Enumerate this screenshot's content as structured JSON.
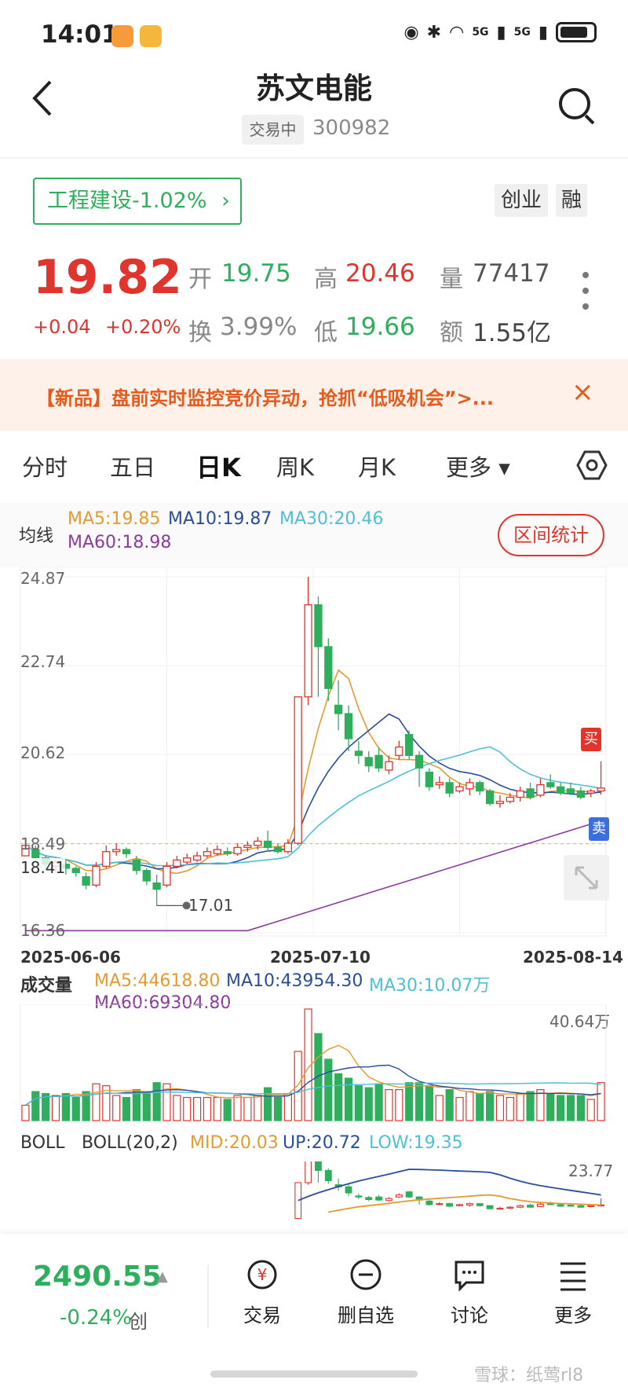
{
  "status_bar": {
    "time": "14:01",
    "network_1": "5G",
    "network_2": "5G",
    "colors": {
      "badge1": "#f59b3a",
      "badge2": "#f5b73a"
    }
  },
  "header": {
    "title": "苏文电能",
    "trading_status": "交易中",
    "code": "300982"
  },
  "sector": {
    "label": "工程建设-1.02%",
    "tags": [
      "创业",
      "融"
    ]
  },
  "quote": {
    "price": "19.82",
    "change": "+0.04",
    "change_pct": "+0.20%",
    "open_label": "开",
    "open": "19.75",
    "high_label": "高",
    "high": "20.46",
    "volume_label": "量",
    "volume": "77417",
    "turnover_label": "换",
    "turnover": "3.99%",
    "low_label": "低",
    "low": "19.66",
    "amount_label": "额",
    "amount": "1.55亿"
  },
  "promo": {
    "text": "【新品】盘前实时监控竞价异动，抢抓“低吸机会”>...",
    "close": "×"
  },
  "period_tabs": [
    "分时",
    "五日",
    "日K",
    "周K",
    "月K",
    "更多 ▾"
  ],
  "active_tab": "日K",
  "ma_legend": {
    "label": "均线",
    "ma5": "MA5:19.85",
    "ma10": "MA10:19.87",
    "ma30": "MA30:20.46",
    "ma60": "MA60:18.98",
    "range_button": "区间统计"
  },
  "colors": {
    "up": "#e0342c",
    "down": "#2fae5d",
    "ma5": "#e59a2f",
    "ma10": "#2a4d9b",
    "ma30": "#4fbfd6",
    "ma60": "#8a3b9c"
  },
  "chart_data": [
    {
      "type": "candlestick",
      "y_ticks": [
        "24.87",
        "22.74",
        "20.62",
        "18.49",
        "16.36"
      ],
      "ylim": [
        16.36,
        24.87
      ],
      "x_labels": [
        "2025-06-06",
        "2025-07-10",
        "2025-08-14"
      ],
      "annotations": {
        "current_line": "18.41",
        "low_marker": "17.01",
        "buy_mark": "买",
        "sell_mark": "卖"
      },
      "candles": [
        [
          18.2,
          18.45,
          18.0,
          17.95
        ],
        [
          18.35,
          18.15,
          18.45,
          18.05
        ],
        [
          18.15,
          18.0,
          18.2,
          17.85
        ],
        [
          17.95,
          18.05,
          18.1,
          17.8
        ],
        [
          18.0,
          17.9,
          18.1,
          17.75
        ],
        [
          17.9,
          17.8,
          17.95,
          17.7
        ],
        [
          17.7,
          17.5,
          17.8,
          17.4
        ],
        [
          17.5,
          17.95,
          18.05,
          17.45
        ],
        [
          17.95,
          18.3,
          18.45,
          17.9
        ],
        [
          18.3,
          18.35,
          18.5,
          18.2
        ],
        [
          18.35,
          18.25,
          18.4,
          18.15
        ],
        [
          18.1,
          17.85,
          18.2,
          17.75
        ],
        [
          17.85,
          17.6,
          17.9,
          17.5
        ],
        [
          17.55,
          17.4,
          17.75,
          17.01
        ],
        [
          17.5,
          17.95,
          18.05,
          17.45
        ],
        [
          17.95,
          18.1,
          18.2,
          17.9
        ],
        [
          18.05,
          18.15,
          18.25,
          18.0
        ],
        [
          18.1,
          18.2,
          18.3,
          18.05
        ],
        [
          18.2,
          18.3,
          18.4,
          18.15
        ],
        [
          18.25,
          18.35,
          18.45,
          18.2
        ],
        [
          18.3,
          18.25,
          18.4,
          18.2
        ],
        [
          18.25,
          18.4,
          18.5,
          18.2
        ],
        [
          18.4,
          18.45,
          18.55,
          18.3
        ],
        [
          18.45,
          18.55,
          18.65,
          18.35
        ],
        [
          18.55,
          18.4,
          18.8,
          18.3
        ],
        [
          18.4,
          18.3,
          18.5,
          18.25
        ],
        [
          18.3,
          18.5,
          18.6,
          18.25
        ],
        [
          18.5,
          22.0,
          22.0,
          18.45
        ],
        [
          22.0,
          24.2,
          24.87,
          21.8
        ],
        [
          24.2,
          23.2,
          24.4,
          22.0
        ],
        [
          23.2,
          22.2,
          23.4,
          21.9
        ],
        [
          21.8,
          21.6,
          22.4,
          21.2
        ],
        [
          21.6,
          21.0,
          21.8,
          20.7
        ],
        [
          20.7,
          20.6,
          20.95,
          20.4
        ],
        [
          20.55,
          20.35,
          20.7,
          20.2
        ],
        [
          20.6,
          20.3,
          20.8,
          20.2
        ],
        [
          20.25,
          20.45,
          20.6,
          20.15
        ],
        [
          20.6,
          20.8,
          20.95,
          20.5
        ],
        [
          21.1,
          20.6,
          21.2,
          20.5
        ],
        [
          20.6,
          20.3,
          20.7,
          19.85
        ],
        [
          20.2,
          19.85,
          20.3,
          19.75
        ],
        [
          19.9,
          19.95,
          20.1,
          19.8
        ],
        [
          19.95,
          19.7,
          20.05,
          19.6
        ],
        [
          19.75,
          19.85,
          19.95,
          19.7
        ],
        [
          19.8,
          19.95,
          20.05,
          19.65
        ],
        [
          19.95,
          19.75,
          20.0,
          19.65
        ],
        [
          19.75,
          19.45,
          19.8,
          19.4
        ],
        [
          19.45,
          19.5,
          19.65,
          19.35
        ],
        [
          19.5,
          19.6,
          19.7,
          19.45
        ],
        [
          19.6,
          19.75,
          19.85,
          19.5
        ],
        [
          19.8,
          19.6,
          19.95,
          19.55
        ],
        [
          19.65,
          19.9,
          20.05,
          19.6
        ],
        [
          19.95,
          19.85,
          20.15,
          19.8
        ],
        [
          19.85,
          19.7,
          19.95,
          19.65
        ],
        [
          19.8,
          19.7,
          19.95,
          19.65
        ],
        [
          19.75,
          19.6,
          19.85,
          19.55
        ],
        [
          19.7,
          19.75,
          19.8,
          19.6
        ],
        [
          19.75,
          19.82,
          20.46,
          19.66
        ]
      ]
    },
    {
      "type": "bar",
      "title": "成交量",
      "legend": {
        "ma5": "MA5:44618.80",
        "ma10": "MA10:43954.30",
        "ma30": "MA30:10.07万",
        "ma60": "MA60:69304.80"
      },
      "max_label": "40.64万"
    },
    {
      "type": "line",
      "title": "BOLL",
      "legend": {
        "params": "BOLL(20,2)",
        "mid": "MID:20.03",
        "up": "UP:20.72",
        "low": "LOW:19.35"
      },
      "max_label": "23.77"
    }
  ],
  "bottom_bar": {
    "index_value": "2490.55",
    "index_arrow": "▲",
    "index_change": "-0.24%",
    "index_market": "创",
    "actions": [
      "交易",
      "删自选",
      "讨论",
      "更多"
    ],
    "watermark": "雪球：纸莺rl8"
  }
}
